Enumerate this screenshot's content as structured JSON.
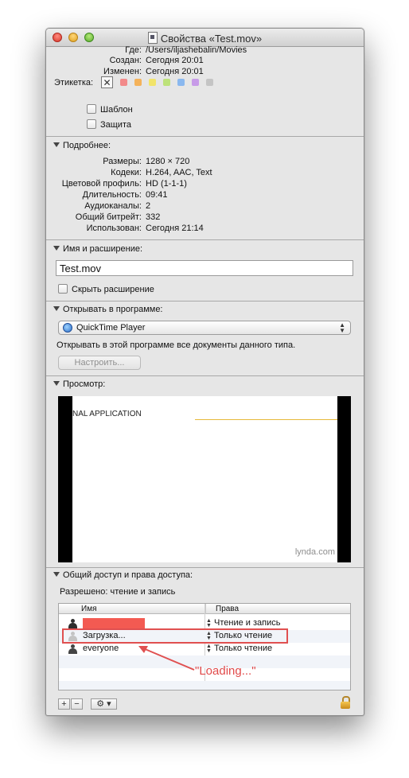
{
  "window": {
    "title": "Свойства «Test.mov»"
  },
  "general": {
    "where_label": "Где:",
    "where_value": "/Users/iljashebalin/Movies",
    "created_label": "Создан:",
    "created_value": "Сегодня 20:01",
    "modified_label": "Изменен:",
    "modified_value": "Сегодня 20:01",
    "label_label": "Этикетка:",
    "label_clear": "✕",
    "label_colors": [
      "#f28a8a",
      "#f4b25a",
      "#f2e46a",
      "#bde27a",
      "#8ab8ef",
      "#c79be8",
      "#c4c4c4"
    ],
    "stationery": "Шаблон",
    "locked": "Защита"
  },
  "more_info": {
    "header": "Подробнее:",
    "rows": [
      {
        "label": "Размеры:",
        "value": "1280 × 720"
      },
      {
        "label": "Кодеки:",
        "value": "H.264, AAC, Text"
      },
      {
        "label": "Цветовой профиль:",
        "value": "HD (1-1-1)"
      },
      {
        "label": "Длительность:",
        "value": "09:41"
      },
      {
        "label": "Аудиоканалы:",
        "value": "2"
      },
      {
        "label": "Общий битрейт:",
        "value": "332"
      },
      {
        "label": "Использован:",
        "value": "Сегодня 21:14"
      }
    ]
  },
  "name_ext": {
    "header": "Имя и расширение:",
    "value": "Test.mov",
    "hide_extension": "Скрыть расширение"
  },
  "open_with": {
    "header": "Открывать в программе:",
    "app": "QuickTime Player",
    "description": "Открывать в этой программе все документы данного типа.",
    "change_all": "Настроить..."
  },
  "preview": {
    "header": "Просмотр:",
    "video_text": "NAL APPLICATION",
    "watermark": "lynda.com"
  },
  "sharing": {
    "header": "Общий доступ и права доступа:",
    "summary": "Разрешено: чтение и запись",
    "col_name": "Имя",
    "col_priv": "Права",
    "rows": [
      {
        "name": "",
        "priv": "Чтение и запись"
      },
      {
        "name": "Загрузка...",
        "priv": "Только чтение"
      },
      {
        "name": "everyone",
        "priv": "Только чтение"
      }
    ],
    "add": "+",
    "remove": "−",
    "gear": "⚙ ▾"
  },
  "annotation": {
    "text": "\"Loading...\"",
    "color": "#e14a4a"
  }
}
